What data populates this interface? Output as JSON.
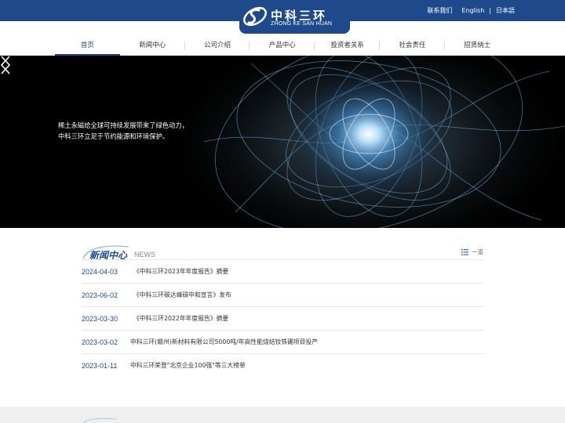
{
  "header": {
    "logo_cn": "中科三环",
    "logo_en": "ZHONG KE SAN HUAN",
    "links": [
      "联系我们",
      "English",
      "日本語"
    ]
  },
  "nav": {
    "items": [
      "首页",
      "新闻中心",
      "公司介绍",
      "产品中心",
      "投资者关系",
      "社会责任",
      "招贤纳士"
    ],
    "active": "首页"
  },
  "banner": {
    "line1": "稀土永磁给全球可持续发展带来了绿色动力，",
    "line2": "中科三环立足于节约能源和环境保护。"
  },
  "news": {
    "title_cn": "新闻中心",
    "title_en": "NEWS",
    "more_label": "一览",
    "items": [
      {
        "date": "2024-04-03",
        "title": "《中科三环2023年年度报告》摘要"
      },
      {
        "date": "2023-06-02",
        "title": "《中科三环碳达峰碳中和宣言》发布"
      },
      {
        "date": "2023-03-30",
        "title": "《中科三环2022年年度报告》摘要"
      },
      {
        "date": "2023-03-02",
        "title": "中科三环(赣州)新材料有限公司5000吨/年高性能烧结钕铁硼项目投产"
      },
      {
        "date": "2023-01-11",
        "title": "中科三环荣登\"北京企业100强\"等三大榜单"
      }
    ]
  },
  "colors": {
    "brand": "#1e4a8c",
    "text": "#333333",
    "divider": "#e6e6e6"
  }
}
